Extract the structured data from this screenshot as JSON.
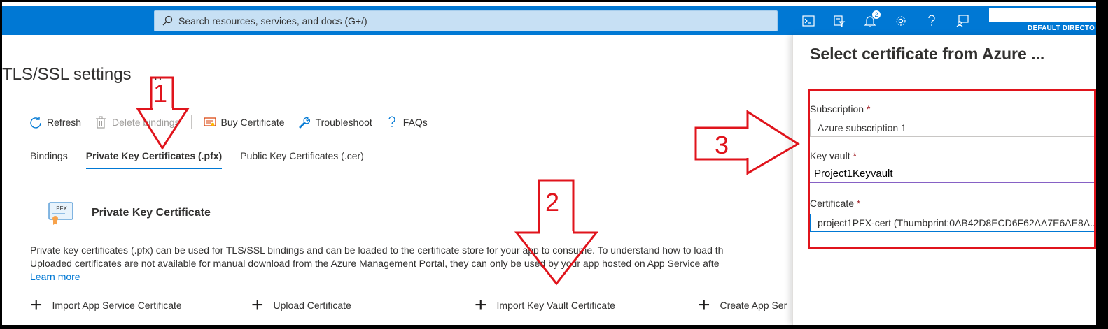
{
  "topbar": {
    "search_placeholder": "Search resources, services, and docs (G+/)",
    "notification_count": "2",
    "directory_label": "DEFAULT DIRECTO"
  },
  "page": {
    "title": "TLS/SSL settings",
    "more": "..."
  },
  "toolbar": {
    "refresh": "Refresh",
    "delete_bindings": "Delete bindings",
    "buy_certificate": "Buy Certificate",
    "troubleshoot": "Troubleshoot",
    "faqs": "FAQs"
  },
  "tabs": [
    {
      "label": "Bindings"
    },
    {
      "label": "Private Key Certificates (.pfx)"
    },
    {
      "label": "Public Key Certificates (.cer)"
    }
  ],
  "section": {
    "title": "Private Key Certificate",
    "icon_text": "PFX",
    "desc_line1": "Private key certificates (.pfx) can be used for TLS/SSL bindings and can be loaded to the certificate store for your app to consume. To understand how to load th",
    "desc_line2": "Uploaded certificates are not available for manual download from the Azure Management Portal, they can only be used by your app hosted on App Service afte",
    "learn_more": "Learn more"
  },
  "commands": [
    {
      "label": "Import App Service Certificate"
    },
    {
      "label": "Upload Certificate"
    },
    {
      "label": "Import Key Vault Certificate"
    },
    {
      "label": "Create App Ser"
    }
  ],
  "blade": {
    "title": "Select certificate from Azure ...",
    "subscription_label": "Subscription",
    "subscription_value": "Azure subscription 1",
    "keyvault_label": "Key vault",
    "keyvault_value": "Project1Keyvault",
    "certificate_label": "Certificate",
    "certificate_value": "project1PFX-cert (Thumbprint:0AB42D8ECD6F62AA7E6AE8A...",
    "required_mark": "*"
  },
  "annotations": {
    "step1": "1",
    "step2": "2",
    "step3": "3"
  },
  "colors": {
    "accent": "#0078d4",
    "annotation_red": "#e0141c"
  }
}
